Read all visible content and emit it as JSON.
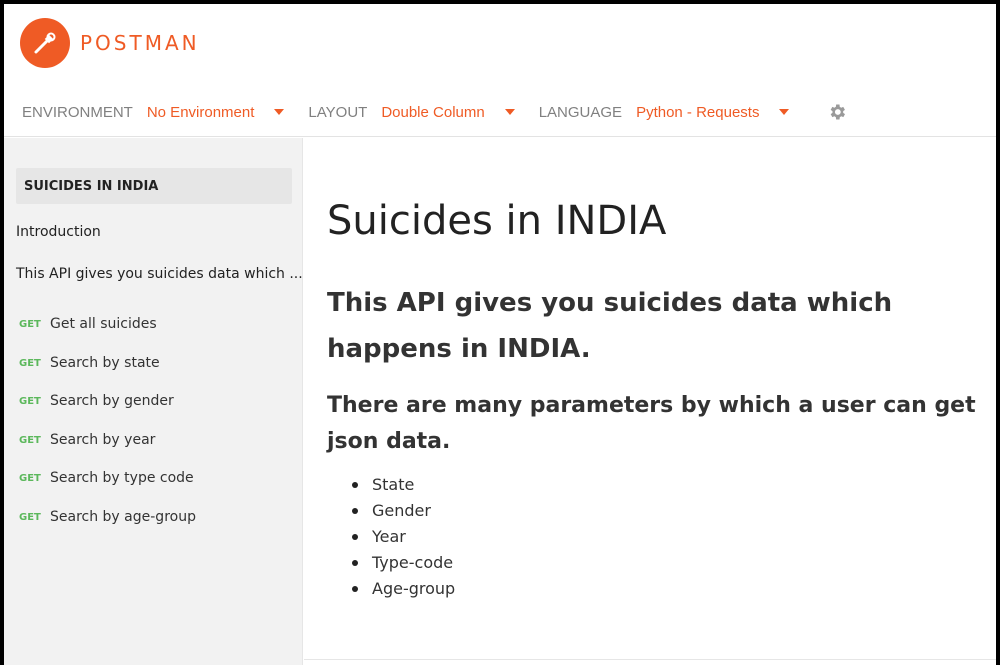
{
  "brand": {
    "name": "POSTMAN",
    "accent": "#ef5b25"
  },
  "toolbar": {
    "environment_label": "ENVIRONMENT",
    "environment_value": "No Environment",
    "layout_label": "LAYOUT",
    "layout_value": "Double Column",
    "language_label": "LANGUAGE",
    "language_value": "Python - Requests",
    "settings_icon": "gear-icon"
  },
  "sidebar": {
    "title": "SUICIDES IN INDIA",
    "intro": "Introduction",
    "summary": "This API gives you suicides data which ...",
    "requests": [
      {
        "method": "GET",
        "name": "Get all suicides"
      },
      {
        "method": "GET",
        "name": "Search by state"
      },
      {
        "method": "GET",
        "name": "Search by gender"
      },
      {
        "method": "GET",
        "name": "Search by year"
      },
      {
        "method": "GET",
        "name": "Search by type code"
      },
      {
        "method": "GET",
        "name": "Search by age-group"
      }
    ]
  },
  "main": {
    "title": "Suicides in INDIA",
    "heading": "This API gives you suicides data which happens in INDIA.",
    "subheading": "There are many parameters by which a user can get json data.",
    "params": [
      "State",
      "Gender",
      "Year",
      "Type-code",
      "Age-group"
    ]
  }
}
